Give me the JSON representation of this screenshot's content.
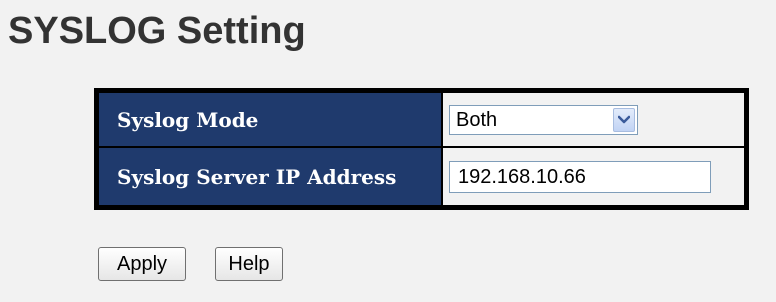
{
  "page": {
    "title": "SYSLOG Setting"
  },
  "syslog": {
    "mode_label": "Syslog Mode",
    "mode_value": "Both",
    "server_ip_label": "Syslog Server IP Address",
    "server_ip_value": "192.168.10.66"
  },
  "buttons": {
    "apply_label": "Apply",
    "help_label": "Help"
  },
  "icons": {
    "select_arrow": "chevron-down-icon"
  },
  "colors": {
    "label_background": "#1f3a6d",
    "label_text": "#ffffff",
    "page_background": "#f2f2f2"
  }
}
